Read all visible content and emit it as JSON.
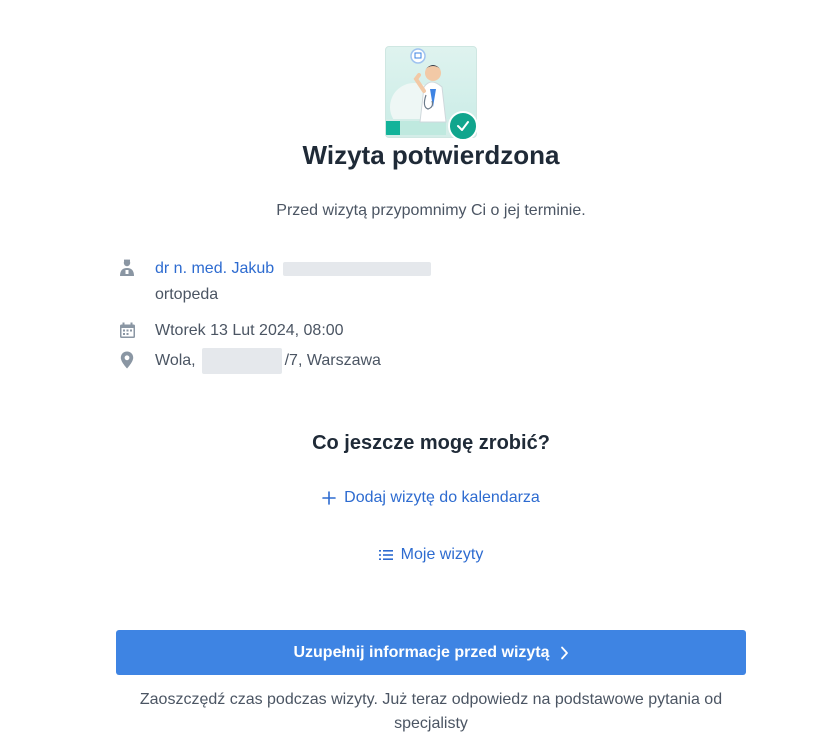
{
  "confirmation": {
    "title": "Wizyta potwierdzona",
    "subtitle": "Przed wizytą przypomnimy Ci o jej terminie."
  },
  "appointment": {
    "doctor_name": "dr n. med. Jakub",
    "specialty": "ortopeda",
    "datetime": "Wtorek 13 Lut 2024, 08:00",
    "address_prefix": "Wola,",
    "address_suffix": "/7, Warszawa"
  },
  "actions": {
    "section_title": "Co jeszcze mogę zrobić?",
    "add_to_calendar": "Dodaj wizytę do kalendarza",
    "my_visits": "Moje wizyty"
  },
  "cta": {
    "button_label": "Uzupełnij informacje przed wizytą",
    "note": "Zaoszczędź czas podczas wizyty. Już teraz odpowiedz na podstawowe pytania od specjalisty"
  },
  "colors": {
    "accent": "#3e84e3",
    "link": "#2d6bd0",
    "success": "#11a58d"
  },
  "icons": {
    "doctor": "doctor-icon",
    "calendar": "calendar-icon",
    "location": "location-pin-icon",
    "plus": "plus-icon",
    "list": "list-icon",
    "chevron": "chevron-right-icon",
    "check": "check-icon"
  }
}
